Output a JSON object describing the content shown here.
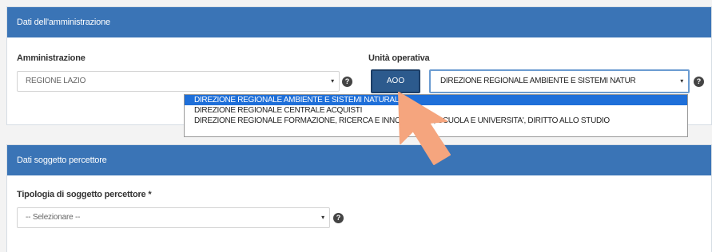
{
  "section_amministrazione": {
    "title": "Dati dell'amministrazione",
    "amministrazione_label": "Amministrazione",
    "amministrazione_value": "REGIONE LAZIO",
    "unita_label": "Unità operativa",
    "aoo_label": "AOO",
    "unita_value": "DIREZIONE REGIONALE AMBIENTE E SISTEMI NATUR",
    "dropdown_options": [
      "DIREZIONE REGIONALE AMBIENTE E SISTEMI NATURALI",
      "DIREZIONE REGIONALE CENTRALE ACQUISTI",
      "DIREZIONE REGIONALE FORMAZIONE, RICERCA E INNOVAZIONE, SCUOLA E UNIVERSITA', DIRITTO ALLO STUDIO"
    ]
  },
  "section_soggetto": {
    "title": "Dati soggetto percettore",
    "tipologia_label": "Tipologia di soggetto percettore *",
    "tipologia_value": "-- Selezionare --"
  },
  "icons": {
    "caret": "▾",
    "help": "?"
  },
  "colors": {
    "header": "#3a74b6",
    "aoo_button": "#2c5a8d",
    "selected_option": "#1e6fd9",
    "cursor": "#f5a57e"
  }
}
